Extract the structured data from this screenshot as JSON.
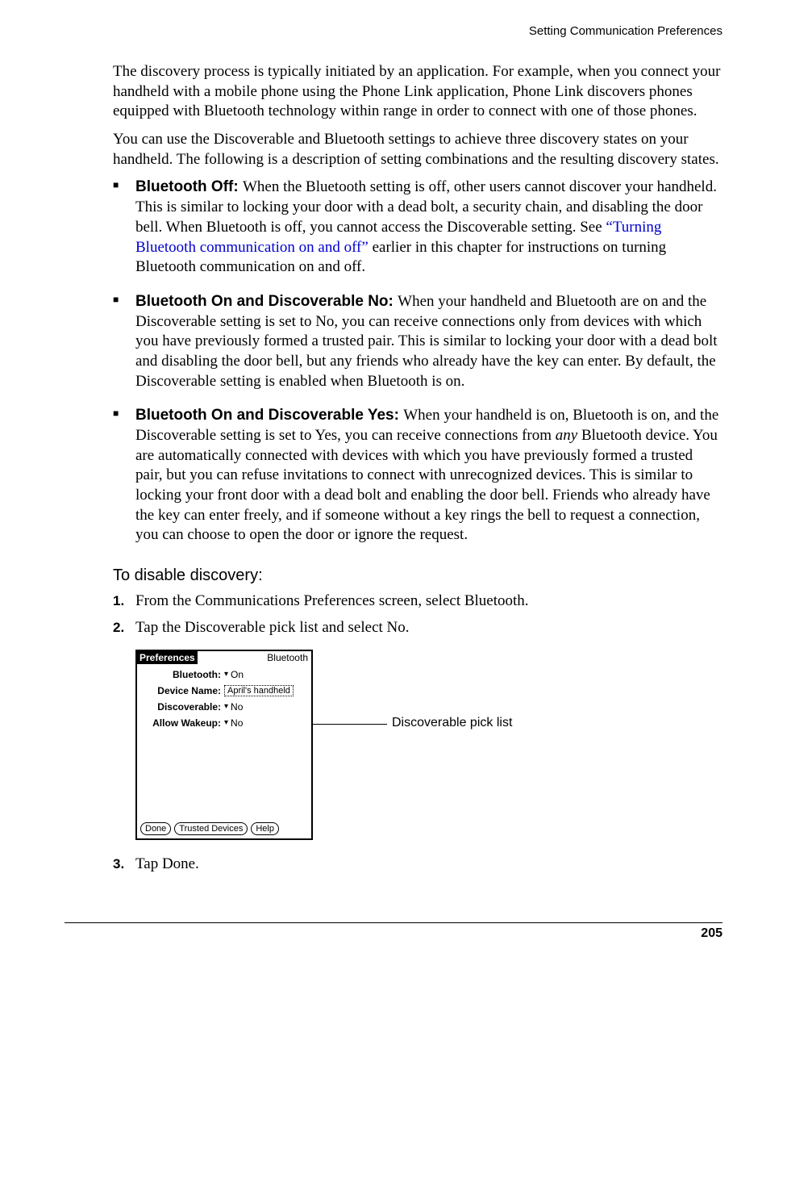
{
  "header": {
    "section_title": "Setting Communication Preferences"
  },
  "paragraphs": {
    "p1": "The discovery process is typically initiated by an application. For example, when you connect your handheld with a mobile phone using the Phone Link application, Phone Link discovers phones equipped with Bluetooth technology within range in order to connect with one of those phones.",
    "p2": "You can use the Discoverable and Bluetooth settings to achieve three discovery states on your handheld. The following is a description of setting combinations and the resulting discovery states."
  },
  "bullets": [
    {
      "label": "Bluetooth Off: ",
      "text_before_link": "When the Bluetooth setting is off, other users cannot discover your handheld. This is similar to locking your door with a dead bolt, a security chain, and disabling the door bell. When Bluetooth is off, you cannot access the Discoverable setting. See ",
      "link": "“Turning Bluetooth communication on and off”",
      "text_after_link": " earlier in this chapter for instructions on turning Bluetooth communication on and off."
    },
    {
      "label": "Bluetooth On and Discoverable No: ",
      "text": "When your handheld and Bluetooth are on and the Discoverable setting is set to No, you can receive connections only from devices with which you have previously formed a trusted pair. This is similar to locking your door with a dead bolt and disabling the door bell, but any friends who already have the key can enter. By default, the Discoverable setting is enabled when Bluetooth is on."
    },
    {
      "label": "Bluetooth On and Discoverable Yes: ",
      "text_before_italic": "When your handheld is on, Bluetooth is on, and the Discoverable setting is set to Yes, you can receive connections from ",
      "italic": "any",
      "text_after_italic": " Bluetooth device. You are automatically connected with devices with which you have previously formed a trusted pair, but you can refuse invitations to connect with unrecognized devices. This is similar to locking your front door with a dead bolt and enabling the door bell. Friends who already have the key can enter freely, and if someone without a key rings the bell to request a connection, you can choose to open the door or ignore the request."
    }
  ],
  "procedure": {
    "heading": "To disable discovery:",
    "steps": [
      "From the Communications Preferences screen, select Bluetooth.",
      "Tap the Discoverable pick list and select No.",
      "Tap Done."
    ]
  },
  "palm": {
    "title": "Preferences",
    "right_title": "Bluetooth",
    "fields": {
      "bluetooth_label": "Bluetooth:",
      "bluetooth_value": "On",
      "device_name_label": "Device Name:",
      "device_name_value": "April's handheld",
      "discoverable_label": "Discoverable:",
      "discoverable_value": "No",
      "allow_wakeup_label": "Allow Wakeup:",
      "allow_wakeup_value": "No"
    },
    "buttons": {
      "done": "Done",
      "trusted": "Trusted Devices",
      "help": "Help"
    }
  },
  "callout": "Discoverable pick list",
  "footer": {
    "page_number": "205"
  }
}
